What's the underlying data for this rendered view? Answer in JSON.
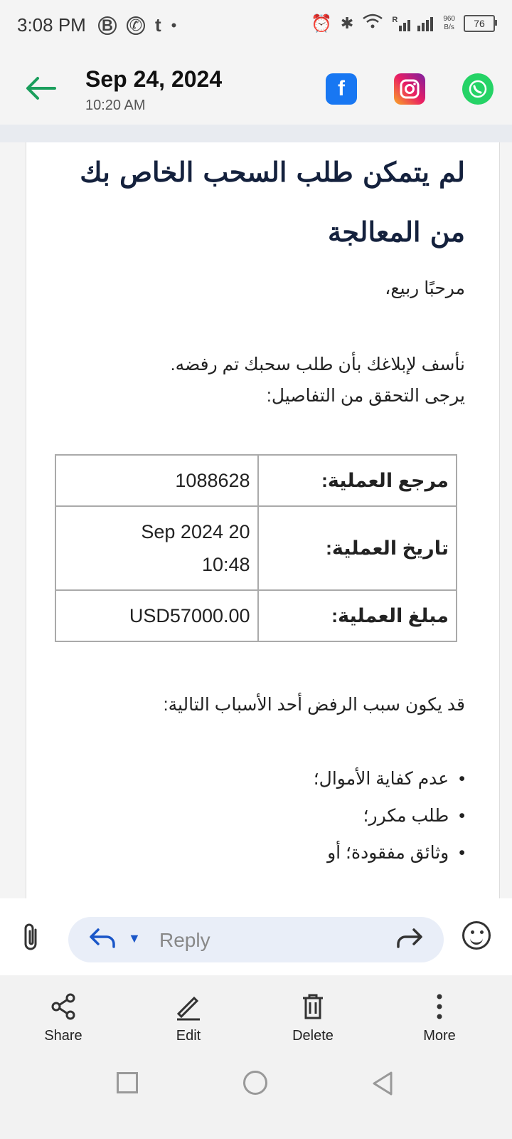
{
  "status_bar": {
    "time": "3:08 PM",
    "network_speed_value": "960",
    "network_speed_unit": "B/s",
    "signal_label": "R",
    "battery": "76"
  },
  "header": {
    "date": "Sep 24, 2024",
    "time": "10:20 AM",
    "social_icons": [
      "facebook-icon",
      "instagram-icon",
      "whatsapp-icon"
    ]
  },
  "email": {
    "title": "لم يتمكن طلب السحب الخاص بك من المعالجة",
    "greeting": "مرحبًا ربيع،",
    "body_line1": "نأسف لإبلاغك بأن طلب سحبك تم رفضه.",
    "body_line2": "يرجى التحقق من التفاصيل:",
    "table": [
      {
        "label": "مرجع العملية:",
        "value": "1088628"
      },
      {
        "label": "تاريخ العملية:",
        "value": "Sep 2024 20 10:48"
      },
      {
        "label": "مبلغ العملية:",
        "value": "USD57000.00"
      }
    ],
    "reasons_intro": "قد يكون سبب الرفض أحد الأسباب التالية:",
    "reasons": [
      "عدم كفاية الأموال؛",
      "طلب مكرر؛",
      "وثائق مفقودة؛ أو"
    ]
  },
  "reply_bar": {
    "placeholder": "Reply"
  },
  "actions": [
    {
      "label": "Share",
      "icon": "share-icon"
    },
    {
      "label": "Edit",
      "icon": "edit-icon"
    },
    {
      "label": "Delete",
      "icon": "delete-icon"
    },
    {
      "label": "More",
      "icon": "more-icon"
    }
  ],
  "colors": {
    "accent_green": "#1a9e5c",
    "reply_blue": "#1a56c8",
    "title_navy": "#14213d"
  }
}
